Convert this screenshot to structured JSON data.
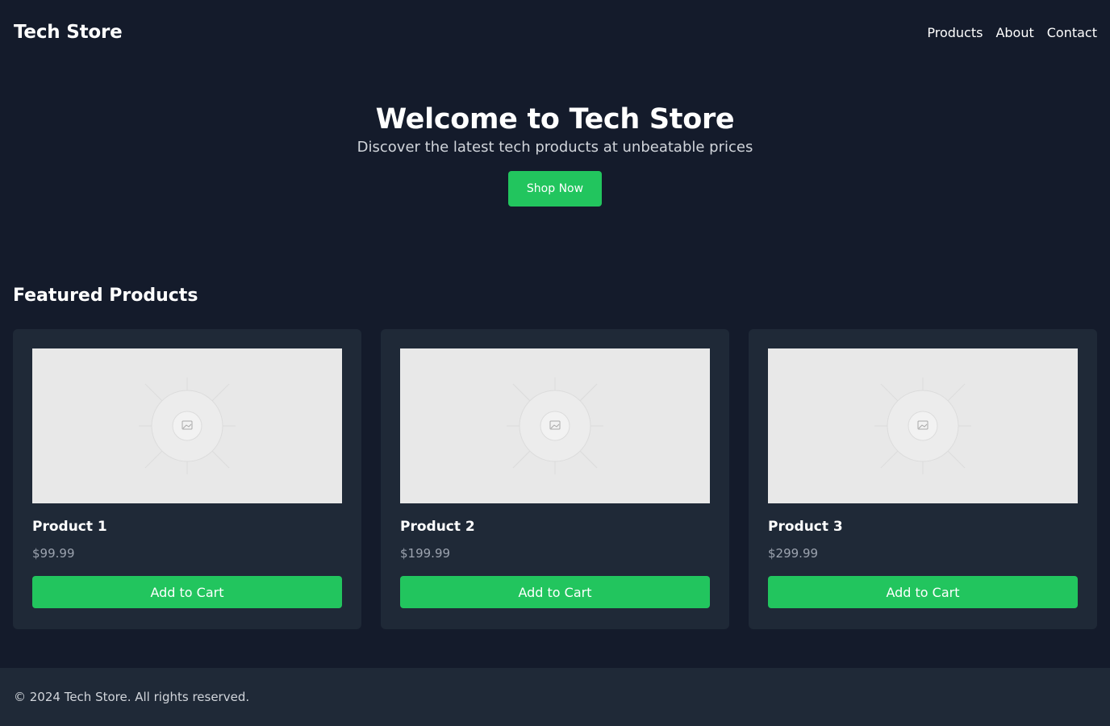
{
  "header": {
    "brand": "Tech Store",
    "nav": [
      "Products",
      "About",
      "Contact"
    ]
  },
  "hero": {
    "title": "Welcome to Tech Store",
    "subtitle": "Discover the latest tech products at unbeatable prices",
    "cta": "Shop Now"
  },
  "featured": {
    "title": "Featured Products",
    "products": [
      {
        "name": "Product 1",
        "price": "$99.99",
        "button": "Add to Cart",
        "image_icon": "image-placeholder-icon"
      },
      {
        "name": "Product 2",
        "price": "$199.99",
        "button": "Add to Cart",
        "image_icon": "image-placeholder-icon"
      },
      {
        "name": "Product 3",
        "price": "$299.99",
        "button": "Add to Cart",
        "image_icon": "image-placeholder-icon"
      }
    ]
  },
  "footer": {
    "text": "© 2024 Tech Store. All rights reserved."
  },
  "colors": {
    "background": "#141b2b",
    "surface": "#1f2937",
    "accent": "#22c55e",
    "muted_text": "#9ca3af"
  }
}
